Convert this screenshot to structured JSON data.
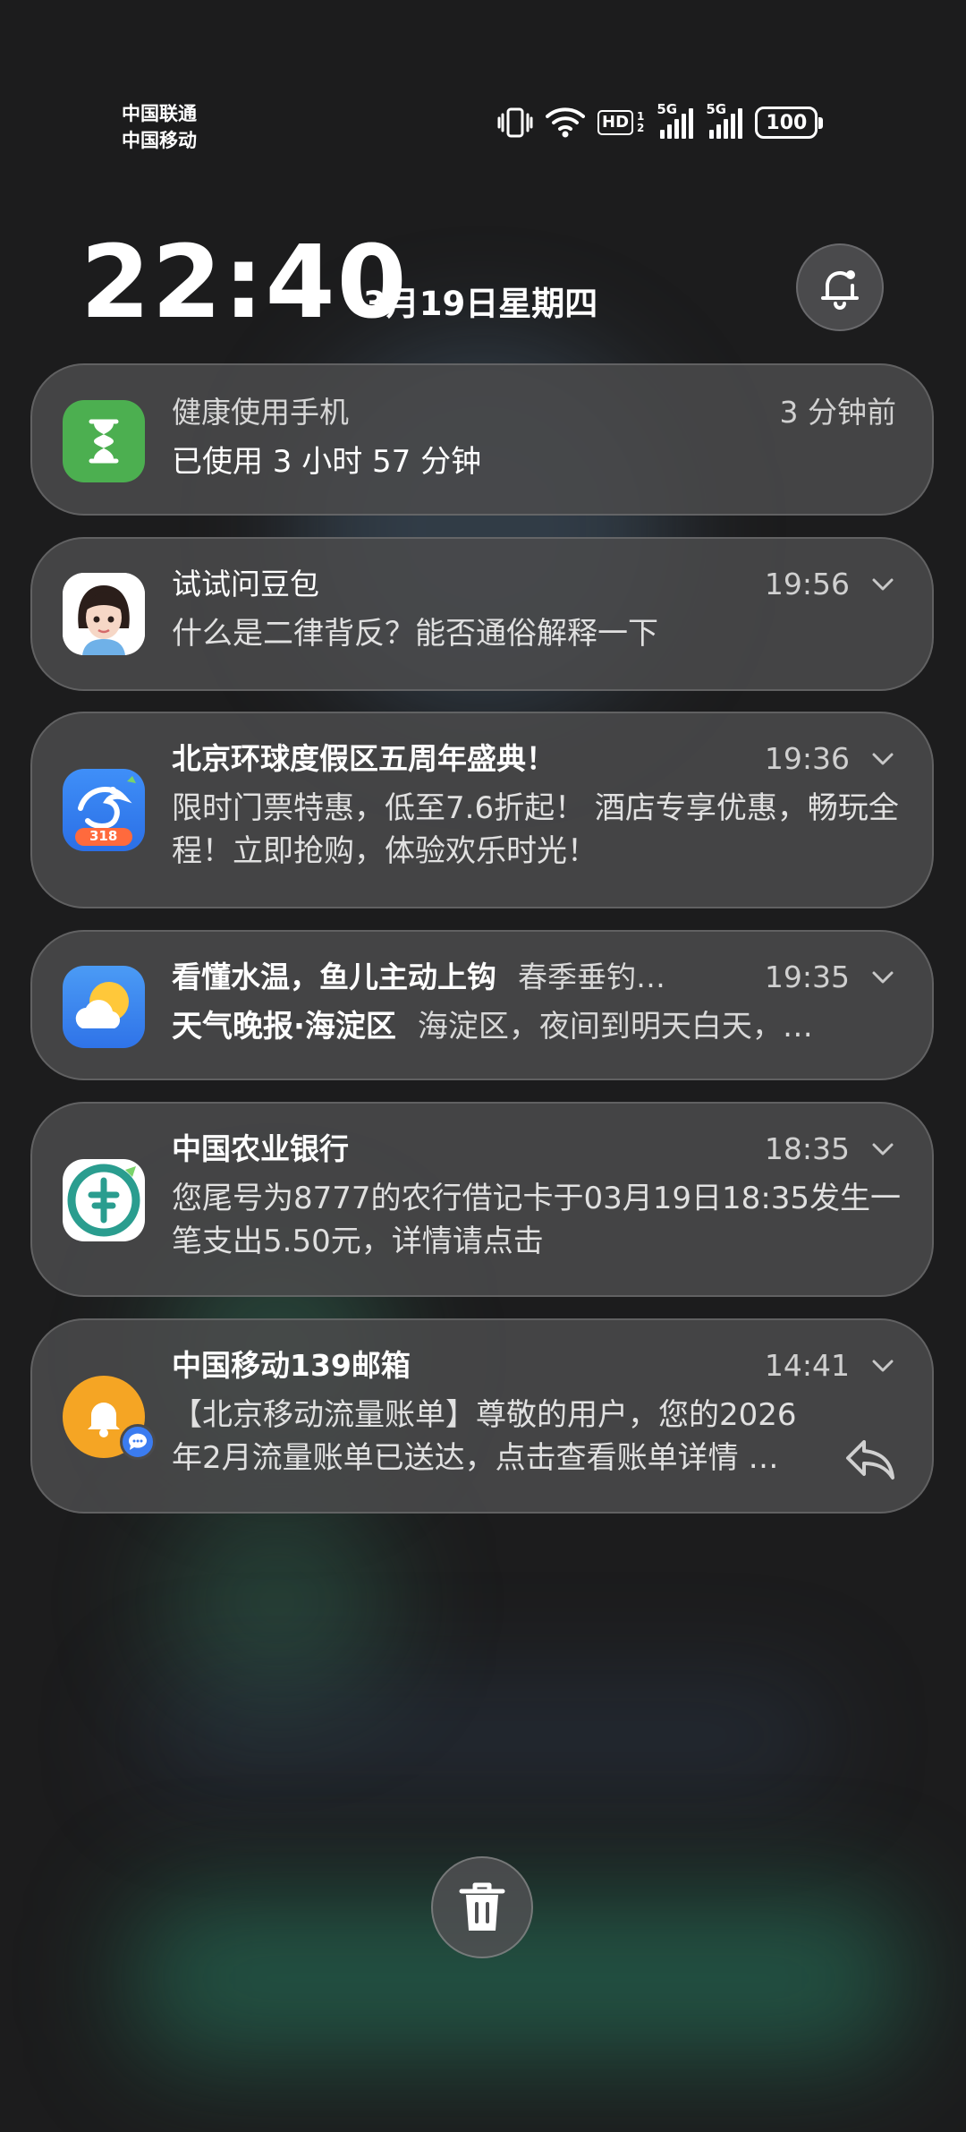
{
  "status_bar": {
    "carrier_1": "中国联通",
    "carrier_2": "中国移动",
    "hd_label": "HD",
    "hd_sub_1": "1",
    "hd_sub_2": "2",
    "sim1_network": "5G",
    "sim2_network": "5G",
    "battery": "100"
  },
  "lockscreen": {
    "time": "22:40",
    "date": "3月19日星期四"
  },
  "notifications": [
    {
      "app": "健康使用手机",
      "time": "3 分钟前",
      "body": "已使用 3 小时 57 分钟",
      "icon": "hourglass-icon",
      "icon_color": "#4caf50"
    },
    {
      "app": "试试问豆包",
      "time": "19:56",
      "body": "什么是二律背反？能否通俗解释一下",
      "icon": "doubao-avatar-icon"
    },
    {
      "app": "北京环球度假区五周年盛典！",
      "time": "19:36",
      "body": "限时门票特惠，低至7.6折起！ 酒店专享优惠，畅玩全程！立即抢购，体验欢乐时光！",
      "icon": "ctrip-dolphin-icon",
      "icon_color": "#2f7cf6",
      "badge": "318"
    },
    {
      "app": "看懂水温，鱼儿主动上钩",
      "title_extra": "春季垂钓…",
      "time": "19:35",
      "body_title": "天气晚报·海淀区",
      "body": "海淀区，夜间到明天白天，…",
      "icon": "weather-sun-cloud-icon",
      "icon_color": "#3d86f0"
    },
    {
      "app": "中国农业银行",
      "time": "18:35",
      "body": "您尾号为8777的农行借记卡于03月19日18:35发生一笔支出5.50元，详情请点击",
      "icon": "abc-bank-icon",
      "icon_color": "#2a9d8f"
    },
    {
      "app": "中国移动139邮箱",
      "time": "14:41",
      "body": "【北京移动流量账单】尊敬的用户，您的2026年2月流量账单已送达，点击查看账单详情 …",
      "icon": "bell-app-icon",
      "icon_color": "#f5a524"
    }
  ]
}
